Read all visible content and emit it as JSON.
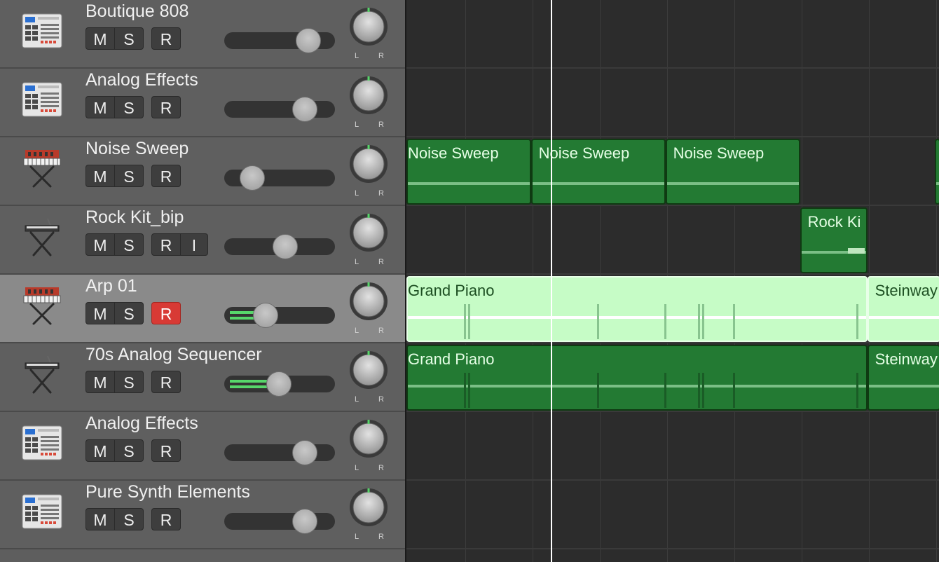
{
  "colors": {
    "header_bg": "#5f5f5f",
    "header_selected_bg": "#8a8a8a",
    "record_armed": "#d83a35",
    "region_green": "#237a33",
    "region_selected": "#c6fcc6",
    "meter_green": "#57d66a",
    "playhead": "#ffffff"
  },
  "tracks": [
    {
      "name": "Boutique 808",
      "icon": "drum-machine-icon",
      "mute": "M",
      "solo": "S",
      "record": "R",
      "input": "",
      "armed": false,
      "selected": false,
      "volume": 0.74,
      "meter": 0,
      "pan": 0
    },
    {
      "name": "Analog Effects",
      "icon": "drum-machine-icon",
      "mute": "M",
      "solo": "S",
      "record": "R",
      "input": "",
      "armed": false,
      "selected": false,
      "volume": 0.71,
      "meter": 0,
      "pan": 0
    },
    {
      "name": "Noise Sweep",
      "icon": "synth-keyboard-icon",
      "mute": "M",
      "solo": "S",
      "record": "R",
      "input": "",
      "armed": false,
      "selected": false,
      "volume": 0.17,
      "meter": 0,
      "pan": 0
    },
    {
      "name": "Rock Kit_bip",
      "icon": "keyboard-stand-icon",
      "mute": "M",
      "solo": "S",
      "record": "R",
      "input": "I",
      "armed": false,
      "selected": false,
      "volume": 0.51,
      "meter": 0,
      "pan": 0
    },
    {
      "name": "Arp 01",
      "icon": "synth-keyboard-icon",
      "mute": "M",
      "solo": "S",
      "record": "R",
      "input": "",
      "armed": true,
      "selected": true,
      "volume": 0.31,
      "meter": 0.38,
      "pan": 0
    },
    {
      "name": "70s Analog Sequencer",
      "icon": "keyboard-stand-icon",
      "mute": "M",
      "solo": "S",
      "record": "R",
      "input": "",
      "armed": false,
      "selected": false,
      "volume": 0.44,
      "meter": 0.5,
      "pan": 0
    },
    {
      "name": "Analog Effects",
      "icon": "drum-machine-icon",
      "mute": "M",
      "solo": "S",
      "record": "R",
      "input": "",
      "armed": false,
      "selected": false,
      "volume": 0.71,
      "meter": 0,
      "pan": 0
    },
    {
      "name": "Pure Synth Elements",
      "icon": "drum-machine-icon",
      "mute": "M",
      "solo": "S",
      "record": "R",
      "input": "",
      "armed": false,
      "selected": false,
      "volume": 0.71,
      "meter": 0,
      "pan": 0
    }
  ],
  "pan_labels": {
    "left": "L",
    "right": "R"
  },
  "regions": [
    {
      "track": 2,
      "label": "Noise Sweep",
      "start": 0,
      "end": 1.85,
      "style": "dark"
    },
    {
      "track": 2,
      "label": "Noise Sweep",
      "start": 1.85,
      "end": 3.85,
      "style": "dark"
    },
    {
      "track": 2,
      "label": "Noise Sweep",
      "start": 3.85,
      "end": 5.85,
      "style": "dark"
    },
    {
      "track": 2,
      "label": "",
      "start": 7.85,
      "end": 8.2,
      "style": "dark"
    },
    {
      "track": 3,
      "label": "Rock Ki",
      "start": 5.85,
      "end": 6.85,
      "style": "dark"
    },
    {
      "track": 4,
      "label": "Grand Piano",
      "start": 0,
      "end": 6.85,
      "style": "light"
    },
    {
      "track": 4,
      "label": "Steinway",
      "start": 6.85,
      "end": 8.2,
      "style": "light"
    },
    {
      "track": 5,
      "label": "Grand Piano",
      "start": 0,
      "end": 6.85,
      "style": "dark"
    },
    {
      "track": 5,
      "label": "Steinway",
      "start": 6.85,
      "end": 8.2,
      "style": "dark"
    }
  ],
  "playhead_bar": 2.17
}
